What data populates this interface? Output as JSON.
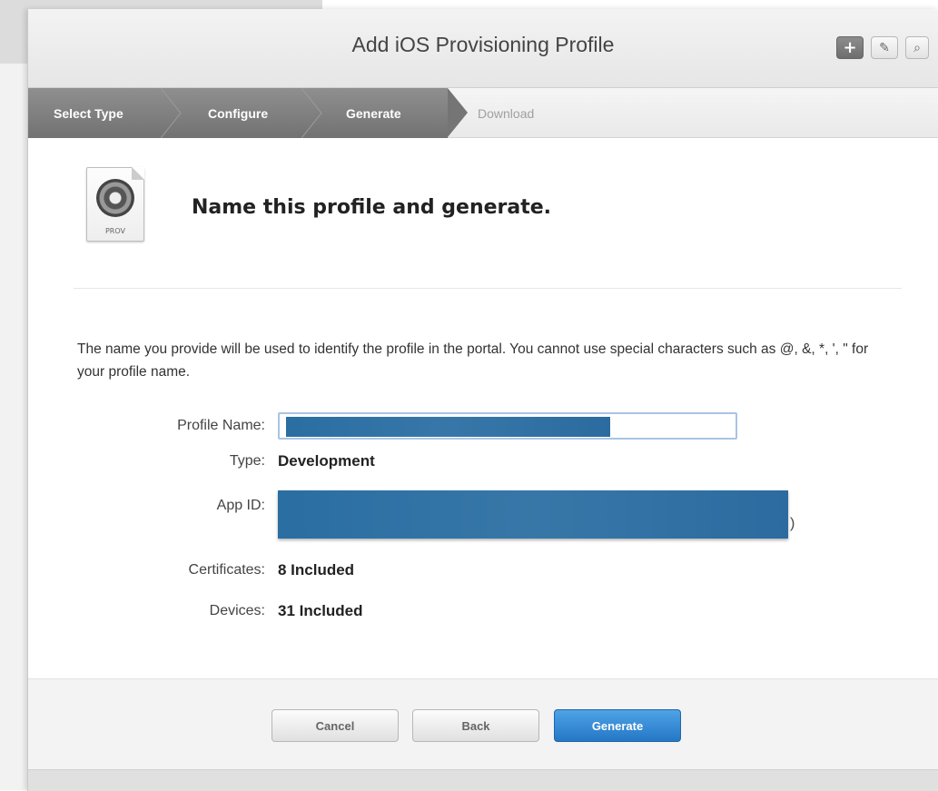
{
  "window": {
    "title": "Add iOS Provisioning Profile",
    "toolbar": {
      "add_icon": "plus-icon",
      "edit_icon": "edit-icon",
      "search_icon": "search-icon"
    }
  },
  "steps": [
    {
      "label": "Select Type",
      "state": "done"
    },
    {
      "label": "Configure",
      "state": "done"
    },
    {
      "label": "Generate",
      "state": "active"
    },
    {
      "label": "Download",
      "state": "pending"
    }
  ],
  "main": {
    "icon_label": "PROV",
    "heading": "Name this profile and generate.",
    "description": "The name you provide will be used to identify the profile in the portal. You cannot use special characters such as @, &, *, ', \" for your profile name.",
    "fields": {
      "profile_name_label": "Profile Name:",
      "type_label": "Type:",
      "type_value": "Development",
      "app_id_label": "App ID:",
      "app_id_trail": ")",
      "certificates_label": "Certificates:",
      "certificates_value": "8 Included",
      "devices_label": "Devices:",
      "devices_value": "31 Included"
    }
  },
  "footer": {
    "cancel_label": "Cancel",
    "back_label": "Back",
    "generate_label": "Generate"
  },
  "colors": {
    "accent": "#2d7fcf",
    "redaction": "#2f71a6",
    "step_active": "#7a7a7a"
  }
}
